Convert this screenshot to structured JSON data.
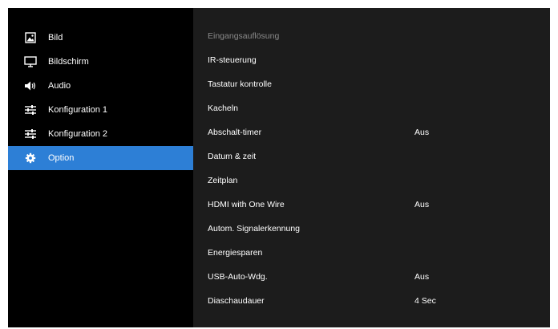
{
  "sidebar": {
    "items": [
      {
        "label": "Bild",
        "icon": "picture-icon"
      },
      {
        "label": "Bildschirm",
        "icon": "monitor-icon"
      },
      {
        "label": "Audio",
        "icon": "speaker-icon"
      },
      {
        "label": "Konfiguration 1",
        "icon": "sliders-icon"
      },
      {
        "label": "Konfiguration 2",
        "icon": "sliders-icon"
      },
      {
        "label": "Option",
        "icon": "gear-icon"
      }
    ],
    "active_index": 5,
    "active_color": "#2d7fd6"
  },
  "main": {
    "rows": [
      {
        "label": "Eingangsauflösung",
        "value": "",
        "disabled": true
      },
      {
        "label": "IR-steuerung",
        "value": ""
      },
      {
        "label": "Tastatur kontrolle",
        "value": ""
      },
      {
        "label": "Kacheln",
        "value": ""
      },
      {
        "label": "Abschalt-timer",
        "value": "Aus"
      },
      {
        "label": "Datum & zeit",
        "value": ""
      },
      {
        "label": "Zeitplan",
        "value": ""
      },
      {
        "label": "HDMI with One Wire",
        "value": "Aus"
      },
      {
        "label": "Autom. Signalerkennung",
        "value": ""
      },
      {
        "label": "Energiesparen",
        "value": ""
      },
      {
        "label": "USB-Auto-Wdg.",
        "value": "Aus"
      },
      {
        "label": "Diaschaudauer",
        "value": "4 Sec"
      }
    ]
  }
}
